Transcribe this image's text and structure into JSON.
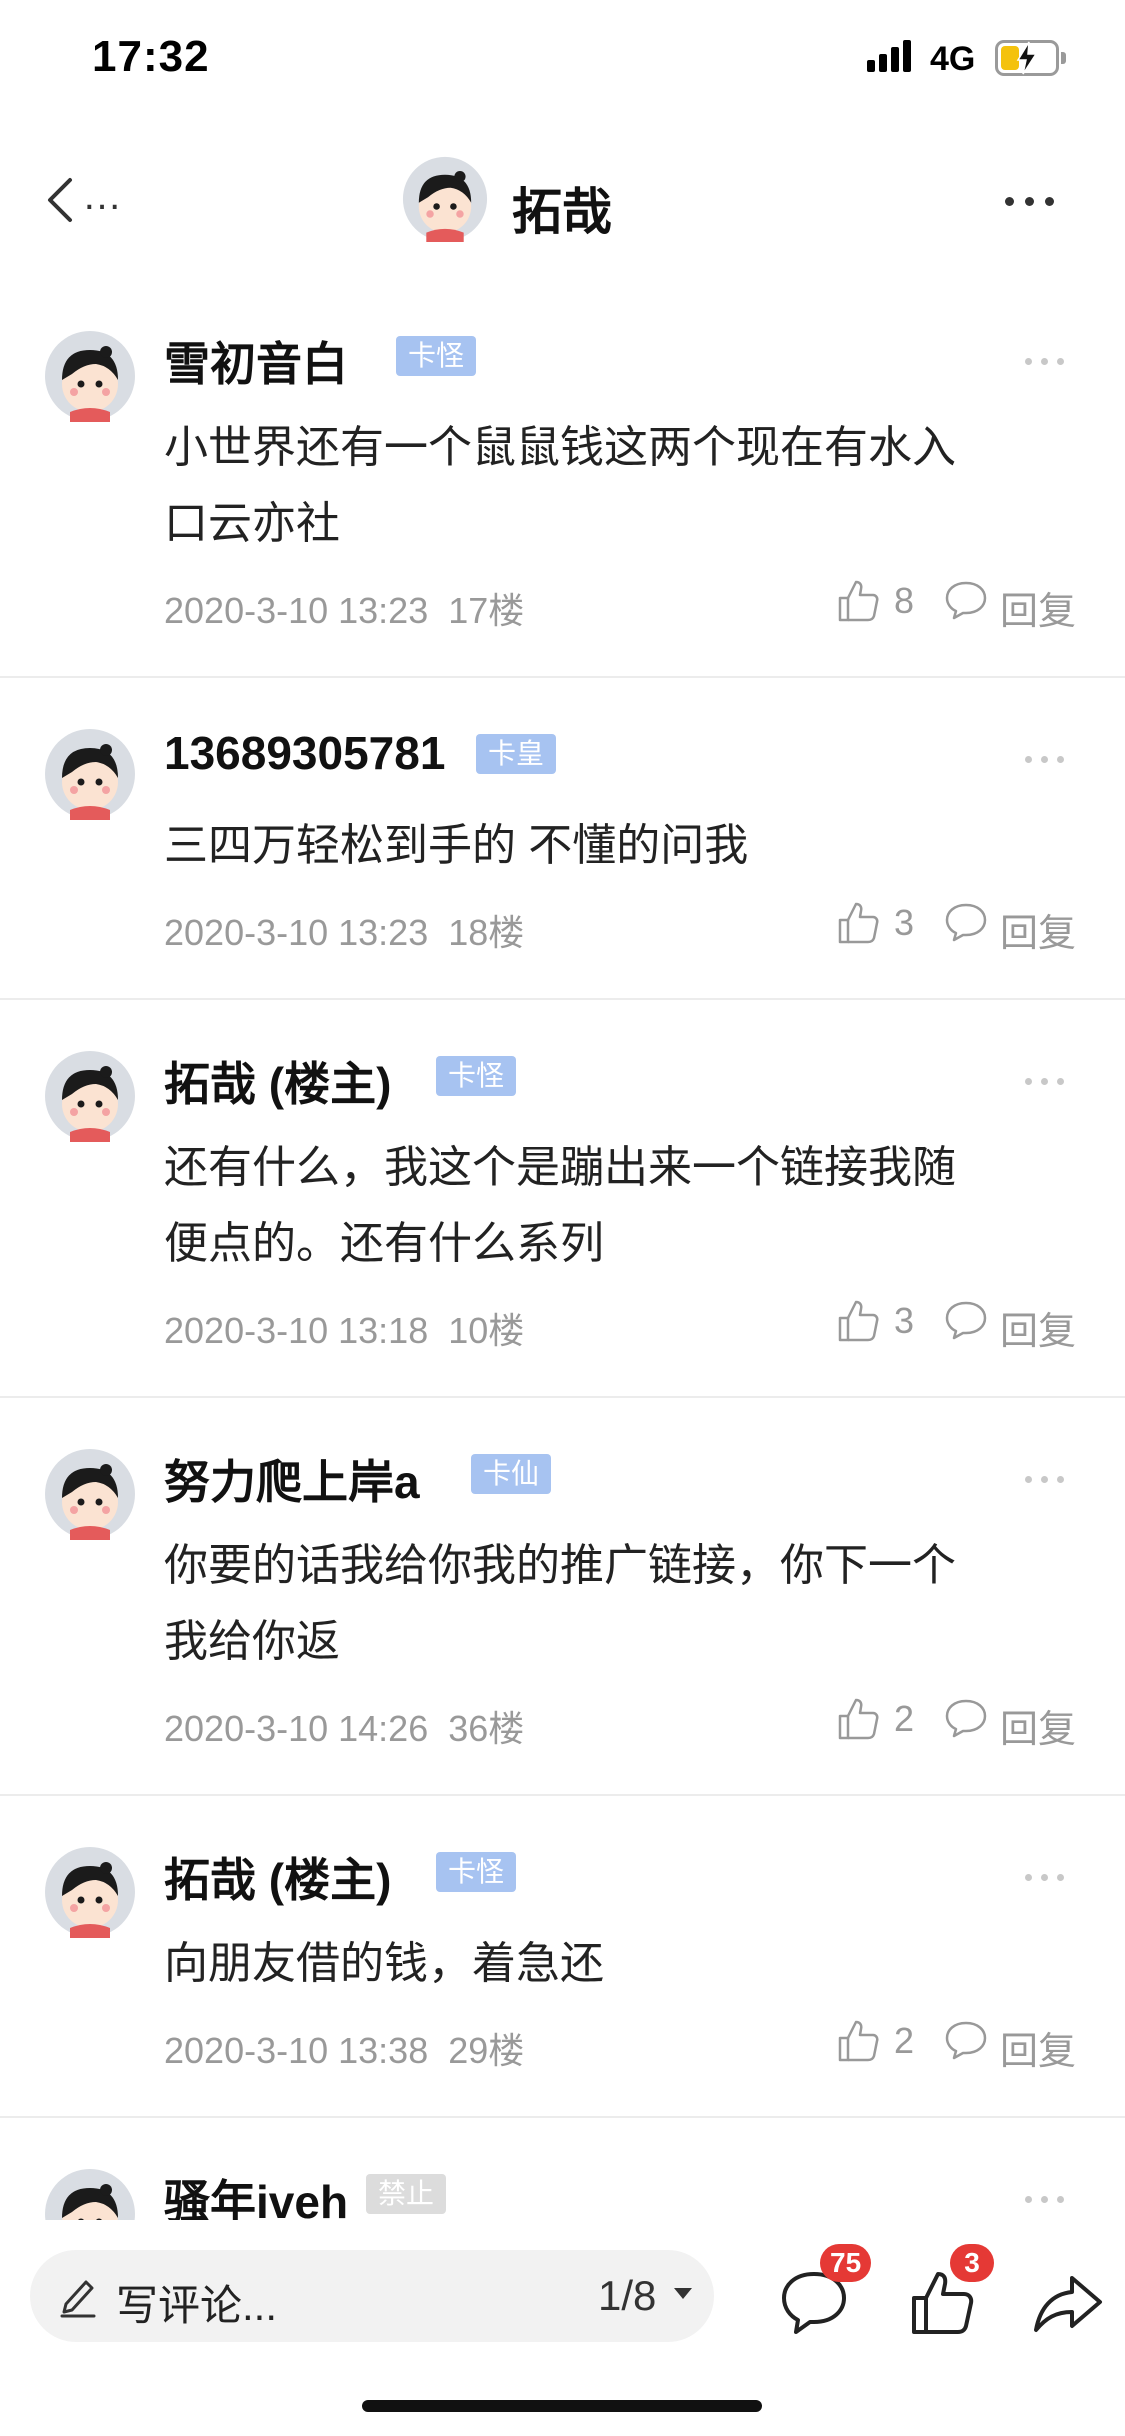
{
  "status_bar": {
    "time": "17:32",
    "network": "4G"
  },
  "nav": {
    "back_more": "…",
    "title": "拓哉"
  },
  "comments": [
    {
      "name": "雪初音白",
      "badge": "卡怪",
      "badge_style": "blue",
      "lines": [
        "小世界还有一个鼠鼠钱这两个现在有水入",
        "口云亦社"
      ],
      "date": "2020-3-10 13:23",
      "floor": "17楼",
      "likes": "8",
      "reply": "回复"
    },
    {
      "name": "13689305781",
      "badge": "卡皇",
      "badge_style": "blue",
      "lines": [
        "三四万轻松到手的 不懂的问我"
      ],
      "date": "2020-3-10 13:23",
      "floor": "18楼",
      "likes": "3",
      "reply": "回复"
    },
    {
      "name": "拓哉 (楼主)",
      "badge": "卡怪",
      "badge_style": "blue",
      "lines": [
        "还有什么，我这个是蹦出来一个链接我随",
        "便点的。还有什么系列"
      ],
      "date": "2020-3-10 13:18",
      "floor": "10楼",
      "likes": "3",
      "reply": "回复"
    },
    {
      "name": "努力爬上岸a",
      "badge": "卡仙",
      "badge_style": "blue",
      "lines": [
        "你要的话我给你我的推广链接，你下一个",
        "我给你返"
      ],
      "date": "2020-3-10 14:26",
      "floor": "36楼",
      "likes": "2",
      "reply": "回复"
    },
    {
      "name": "拓哉 (楼主)",
      "badge": "卡怪",
      "badge_style": "blue",
      "lines": [
        "向朋友借的钱，着急还"
      ],
      "date": "2020-3-10 13:38",
      "floor": "29楼",
      "likes": "2",
      "reply": "回复"
    },
    {
      "name": "骚年iveh",
      "badge": "禁止",
      "badge_style": "grey",
      "lines": [],
      "date": "",
      "floor": "",
      "likes": "",
      "reply": ""
    }
  ],
  "bottom_bar": {
    "compose_placeholder": "写评论...",
    "page_indicator": "1/8",
    "comments_badge": "75",
    "likes_badge": "3"
  },
  "icons": {
    "back": "chevron-left-icon",
    "more": "more-dots-icon",
    "like": "thumbs-up-icon",
    "reply": "speech-bubble-icon",
    "compose": "pencil-icon",
    "share": "share-arrow-icon"
  },
  "colors": {
    "badge_blue": "#a7c3f1",
    "badge_grey": "#dcdcdc",
    "notify_red": "#e53935",
    "meta_grey": "#999999"
  }
}
